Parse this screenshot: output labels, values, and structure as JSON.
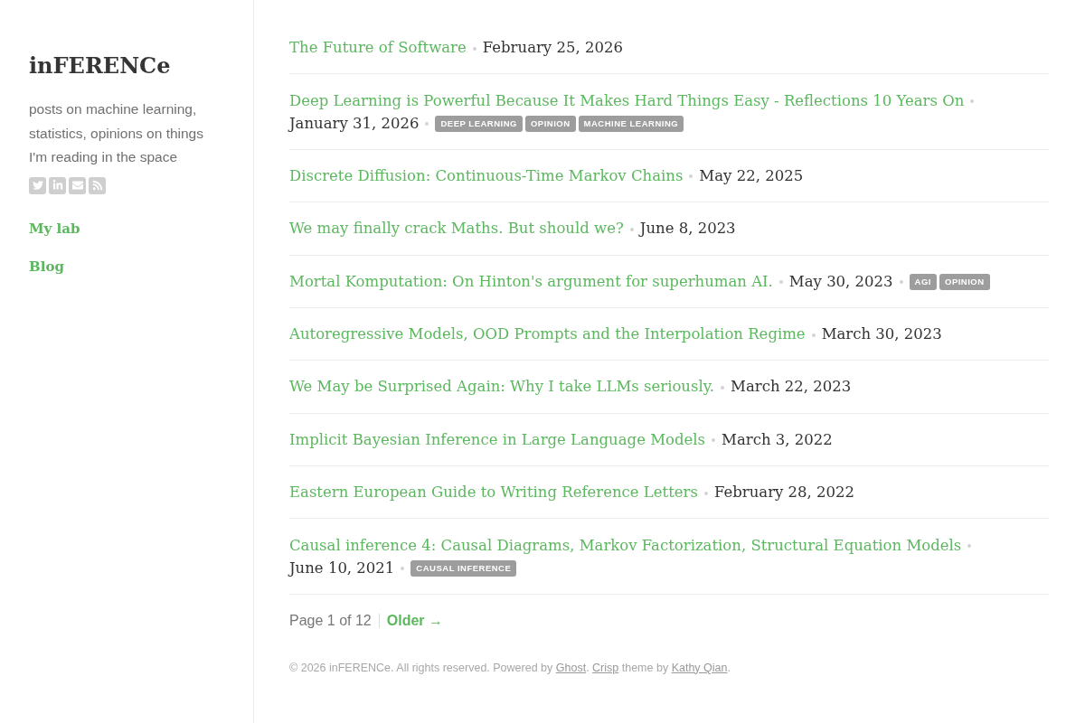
{
  "sidebar": {
    "title": "inFERENCe",
    "description": "posts on machine learning, statistics, opinions on things I'm reading in the space",
    "nav": [
      {
        "label": "My lab"
      },
      {
        "label": "Blog"
      }
    ]
  },
  "posts": [
    {
      "title": "The Future of Software",
      "date": "February 25, 2026"
    },
    {
      "title": "Deep Learning is Powerful Because It Makes Hard Things Easy - Reflections 10 Years On",
      "date": "January 31, 2026",
      "tags": [
        "DEEP LEARNING",
        "OPINION",
        "MACHINE LEARNING"
      ]
    },
    {
      "title": "Discrete Diffusion: Continuous-Time Markov Chains",
      "date": "May 22, 2025"
    },
    {
      "title": "We may finally crack Maths. But should we?",
      "date": "June 8, 2023"
    },
    {
      "title": "Mortal Komputation: On Hinton's argument for superhuman AI.",
      "date": "May 30, 2023",
      "tags": [
        "AGI",
        "OPINION"
      ]
    },
    {
      "title": "Autoregressive Models, OOD Prompts and the Interpolation Regime",
      "date": "March 30, 2023"
    },
    {
      "title": "We May be Surprised Again: Why I take LLMs seriously.",
      "date": "March 22, 2023"
    },
    {
      "title": "Implicit Bayesian Inference in Large Language Models",
      "date": "March 3, 2022"
    },
    {
      "title": "Eastern European Guide to Writing Reference Letters",
      "date": "February 28, 2022"
    },
    {
      "title": "Causal inference 4: Causal Diagrams, Markov Factorization, Structural Equation Models",
      "date": "June 10, 2021",
      "tags": [
        "CAUSAL INFERENCE"
      ]
    }
  ],
  "pagination": {
    "page_info": "Page 1 of 12",
    "older": "Older →"
  },
  "footer": [
    {
      "kind": "text",
      "text": "© 2026 inFERENCe. All rights reserved. Powered by "
    },
    {
      "kind": "link",
      "text": "Ghost"
    },
    {
      "kind": "text",
      "text": ". "
    },
    {
      "kind": "link",
      "text": "Crisp"
    },
    {
      "kind": "text",
      "text": " theme by "
    },
    {
      "kind": "link",
      "text": "Kathy Qian"
    },
    {
      "kind": "text",
      "text": "."
    }
  ]
}
